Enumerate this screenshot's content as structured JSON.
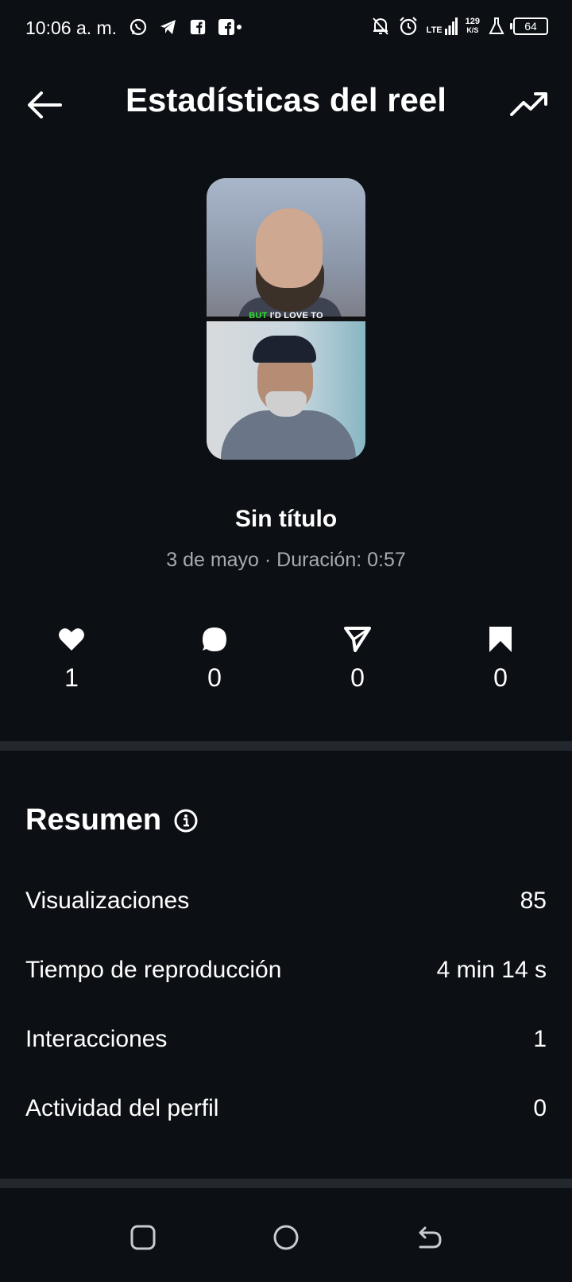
{
  "status_bar": {
    "time": "10:06 a. m.",
    "network": "LTE",
    "speed_value": "129",
    "speed_unit": "K/S",
    "battery": "64",
    "icons": [
      "whatsapp-icon",
      "telegram-icon",
      "facebook-icon",
      "facebook-dot-icon",
      "mute-bell-icon",
      "alarm-icon",
      "signal-icon",
      "lab-icon",
      "battery-icon"
    ]
  },
  "header": {
    "title": "Estadísticas del reel",
    "back_icon": "arrow-left-icon",
    "trend_icon": "trending-up-icon"
  },
  "thumbnail": {
    "caption_highlight": "BUT",
    "caption_rest": " I'D LOVE TO"
  },
  "reel": {
    "title": "Sin título",
    "meta": "3 de mayo · Duración: 0:57"
  },
  "engagement": [
    {
      "icon": "heart-icon",
      "count": "1"
    },
    {
      "icon": "comment-icon",
      "count": "0"
    },
    {
      "icon": "share-icon",
      "count": "0"
    },
    {
      "icon": "bookmark-icon",
      "count": "0"
    }
  ],
  "summary": {
    "title": "Resumen",
    "rows": [
      {
        "label": "Visualizaciones",
        "value": "85"
      },
      {
        "label": "Tiempo de reproducción",
        "value": "4 min 14 s"
      },
      {
        "label": "Interacciones",
        "value": "1"
      },
      {
        "label": "Actividad del perfil",
        "value": "0"
      }
    ]
  },
  "nav": {
    "icons": [
      "recent-apps-icon",
      "home-circle-icon",
      "back-nav-icon"
    ]
  },
  "colors": {
    "background": "#0c0f14",
    "divider": "#23272e",
    "secondary_text": "#a6abb3",
    "caption_highlight": "#2fe02f"
  }
}
